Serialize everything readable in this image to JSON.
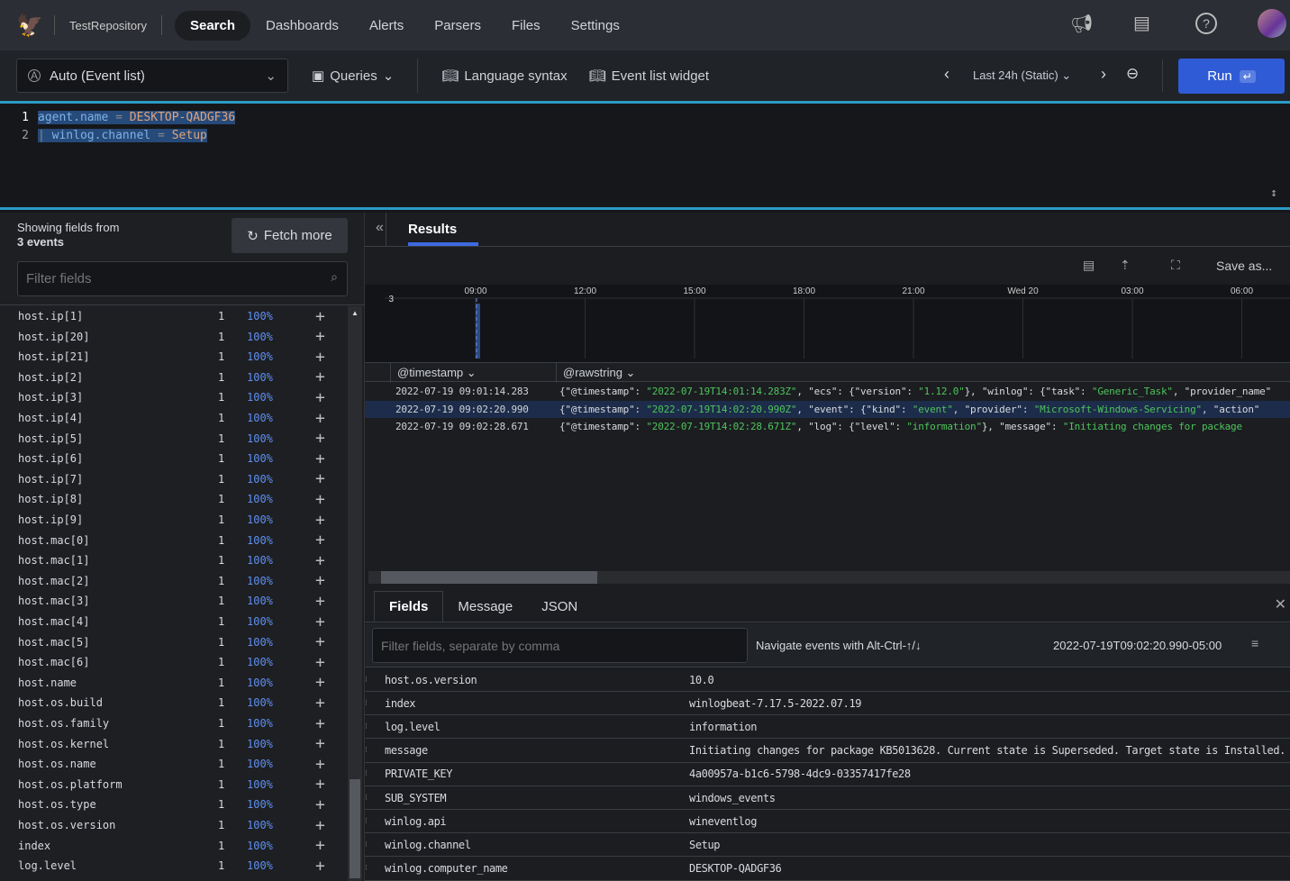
{
  "nav": {
    "repository": "TestRepository",
    "items": [
      "Search",
      "Dashboards",
      "Alerts",
      "Parsers",
      "Files",
      "Settings"
    ]
  },
  "toolbar": {
    "view_mode": "Auto (Event list)",
    "queries": "Queries",
    "language_syntax": "Language syntax",
    "event_list_widget": "Event list widget",
    "time_range": "Last 24h (Static)",
    "run": "Run"
  },
  "editor": {
    "lines": [
      {
        "num": "1",
        "field": "agent.name",
        "op": "=",
        "value": "DESKTOP-QADGF36"
      },
      {
        "num": "2",
        "pipe": "|",
        "field": "winlog.channel",
        "op": "=",
        "value": "Setup"
      }
    ]
  },
  "fields_panel": {
    "showing": "Showing fields from",
    "events": "3 events",
    "fetch_more": "Fetch more",
    "filter_placeholder": "Filter fields",
    "fields": [
      {
        "name": "host.ip[1]",
        "count": "1",
        "pct": "100%"
      },
      {
        "name": "host.ip[20]",
        "count": "1",
        "pct": "100%"
      },
      {
        "name": "host.ip[21]",
        "count": "1",
        "pct": "100%"
      },
      {
        "name": "host.ip[2]",
        "count": "1",
        "pct": "100%"
      },
      {
        "name": "host.ip[3]",
        "count": "1",
        "pct": "100%"
      },
      {
        "name": "host.ip[4]",
        "count": "1",
        "pct": "100%"
      },
      {
        "name": "host.ip[5]",
        "count": "1",
        "pct": "100%"
      },
      {
        "name": "host.ip[6]",
        "count": "1",
        "pct": "100%"
      },
      {
        "name": "host.ip[7]",
        "count": "1",
        "pct": "100%"
      },
      {
        "name": "host.ip[8]",
        "count": "1",
        "pct": "100%"
      },
      {
        "name": "host.ip[9]",
        "count": "1",
        "pct": "100%"
      },
      {
        "name": "host.mac[0]",
        "count": "1",
        "pct": "100%"
      },
      {
        "name": "host.mac[1]",
        "count": "1",
        "pct": "100%"
      },
      {
        "name": "host.mac[2]",
        "count": "1",
        "pct": "100%"
      },
      {
        "name": "host.mac[3]",
        "count": "1",
        "pct": "100%"
      },
      {
        "name": "host.mac[4]",
        "count": "1",
        "pct": "100%"
      },
      {
        "name": "host.mac[5]",
        "count": "1",
        "pct": "100%"
      },
      {
        "name": "host.mac[6]",
        "count": "1",
        "pct": "100%"
      },
      {
        "name": "host.name",
        "count": "1",
        "pct": "100%"
      },
      {
        "name": "host.os.build",
        "count": "1",
        "pct": "100%"
      },
      {
        "name": "host.os.family",
        "count": "1",
        "pct": "100%"
      },
      {
        "name": "host.os.kernel",
        "count": "1",
        "pct": "100%"
      },
      {
        "name": "host.os.name",
        "count": "1",
        "pct": "100%"
      },
      {
        "name": "host.os.platform",
        "count": "1",
        "pct": "100%"
      },
      {
        "name": "host.os.type",
        "count": "1",
        "pct": "100%"
      },
      {
        "name": "host.os.version",
        "count": "1",
        "pct": "100%"
      },
      {
        "name": "index",
        "count": "1",
        "pct": "100%"
      },
      {
        "name": "log.level",
        "count": "1",
        "pct": "100%"
      }
    ]
  },
  "results": {
    "tab": "Results",
    "save_as": "Save as...",
    "chart_data": {
      "type": "bar",
      "x_ticks": [
        "09:00",
        "12:00",
        "15:00",
        "18:00",
        "21:00",
        "Wed 20",
        "03:00",
        "06:00"
      ],
      "y_max": 3,
      "y_tick": "3",
      "bars": [
        {
          "x": "09:00",
          "value": 3
        }
      ]
    },
    "columns": [
      "@timestamp",
      "@rawstring"
    ],
    "events": [
      {
        "timestamp": "2022-07-19 09:01:14.283",
        "raw": [
          [
            "{\"@timestamp\": ",
            ""
          ],
          [
            "\"2022-07-19T14:01:14.283Z\"",
            "g"
          ],
          [
            ", \"ecs\": {\"version\": ",
            ""
          ],
          [
            "\"1.12.0\"",
            "g"
          ],
          [
            "}, \"winlog\": {\"task\": ",
            ""
          ],
          [
            "\"Generic_Task\"",
            "g"
          ],
          [
            ", \"provider_name\"",
            ""
          ]
        ]
      },
      {
        "timestamp": "2022-07-19 09:02:20.990",
        "raw": [
          [
            "{\"@timestamp\": ",
            ""
          ],
          [
            "\"2022-07-19T14:02:20.990Z\"",
            "g"
          ],
          [
            ", \"event\": {\"kind\": ",
            ""
          ],
          [
            "\"event\"",
            "g"
          ],
          [
            ", \"provider\": ",
            ""
          ],
          [
            "\"Microsoft-Windows-Servicing\"",
            "g"
          ],
          [
            ", \"action\"",
            ""
          ]
        ]
      },
      {
        "timestamp": "2022-07-19 09:02:28.671",
        "raw": [
          [
            "{\"@timestamp\": ",
            ""
          ],
          [
            "\"2022-07-19T14:02:28.671Z\"",
            "g"
          ],
          [
            ", \"log\": {\"level\": ",
            ""
          ],
          [
            "\"information\"",
            "g"
          ],
          [
            "}, \"message\": ",
            ""
          ],
          [
            "\"Initiating changes for package",
            "g"
          ]
        ]
      }
    ]
  },
  "details": {
    "tabs": [
      "Fields",
      "Message",
      "JSON"
    ],
    "filter_placeholder": "Filter fields, separate by comma",
    "hint": "Navigate events with Alt-Ctrl-↑/↓",
    "timestamp": "2022-07-19T09:02:20.990-05:00",
    "rows": [
      [
        "host.os.version",
        "10.0"
      ],
      [
        "index",
        "winlogbeat-7.17.5-2022.07.19"
      ],
      [
        "log.level",
        "information"
      ],
      [
        "message",
        "Initiating changes for package KB5013628. Current state is Superseded. Target state is Installed."
      ],
      [
        "PRIVATE_KEY",
        "4a00957a-b1c6-5798-4dc9-03357417fe28"
      ],
      [
        "SUB_SYSTEM",
        "windows_events"
      ],
      [
        "winlog.api",
        "wineventlog"
      ],
      [
        "winlog.channel",
        "Setup"
      ],
      [
        "winlog.computer_name",
        "DESKTOP-QADGF36"
      ]
    ]
  },
  "colors": {
    "accent": "#2f5bd6",
    "editor_border": "#2a9ac4",
    "percent": "#5f8ff0",
    "json_string": "#4fc35b",
    "selected_row": "#1c2c4a"
  }
}
